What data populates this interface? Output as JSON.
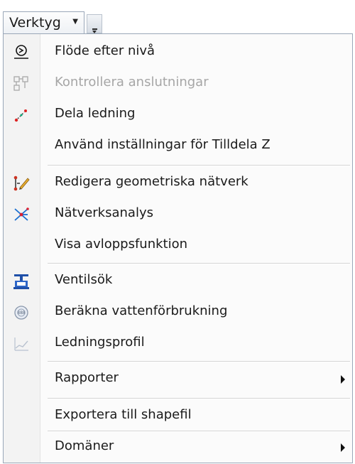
{
  "toolbar": {
    "menu_title": "Verktyg",
    "overflow_icon": "overflow-chevron-icon"
  },
  "menu": {
    "items": [
      {
        "label": "Flöde efter nivå",
        "icon": "flow-level-icon",
        "enabled": true
      },
      {
        "label": "Kontrollera anslutningar",
        "icon": "check-connections-icon",
        "enabled": false
      },
      {
        "label": "Dela ledning",
        "icon": "split-line-icon",
        "enabled": true
      },
      {
        "label": "Använd inställningar för Tilldela Z",
        "icon": "",
        "enabled": true
      },
      {
        "label": "Redigera geometriska nätverk",
        "icon": "edit-network-icon",
        "enabled": true
      },
      {
        "label": "Nätverksanalys",
        "icon": "network-analysis-icon",
        "enabled": true
      },
      {
        "label": "Visa avloppsfunktion",
        "icon": "",
        "enabled": true
      },
      {
        "label": "Ventilsök",
        "icon": "valve-search-icon",
        "enabled": true
      },
      {
        "label": "Beräkna vattenförbrukning",
        "icon": "water-consumption-icon",
        "enabled": true
      },
      {
        "label": "Ledningsprofil",
        "icon": "pipe-profile-icon",
        "enabled": true
      },
      {
        "label": "Rapporter",
        "icon": "",
        "enabled": true,
        "submenu": true
      },
      {
        "label": "Exportera till shapefil",
        "icon": "",
        "enabled": true
      },
      {
        "label": "Domäner",
        "icon": "",
        "enabled": true,
        "submenu": true
      }
    ]
  }
}
